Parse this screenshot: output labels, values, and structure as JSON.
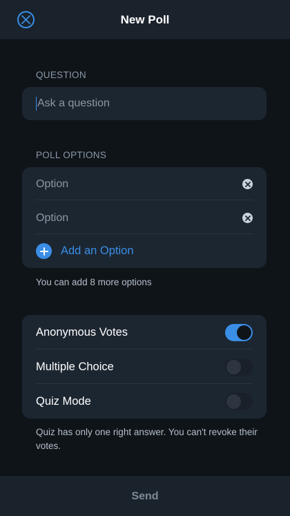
{
  "header": {
    "title": "New Poll",
    "close_icon": "close-circle-icon"
  },
  "question": {
    "section_label": "QUESTION",
    "placeholder": "Ask a question"
  },
  "poll_options": {
    "section_label": "POLL OPTIONS",
    "options": [
      {
        "placeholder": "Option"
      },
      {
        "placeholder": "Option"
      }
    ],
    "add_label": "Add an Option",
    "hint": "You can add 8 more options"
  },
  "settings": {
    "items": [
      {
        "label": "Anonymous Votes",
        "enabled": true
      },
      {
        "label": "Multiple Choice",
        "enabled": false
      },
      {
        "label": "Quiz Mode",
        "enabled": false
      }
    ],
    "footnote": "Quiz has only one right answer. You can't revoke their votes."
  },
  "footer": {
    "send_label": "Send"
  },
  "colors": {
    "accent": "#3a8ee6",
    "background": "#0f1419",
    "card": "#1c2631"
  }
}
